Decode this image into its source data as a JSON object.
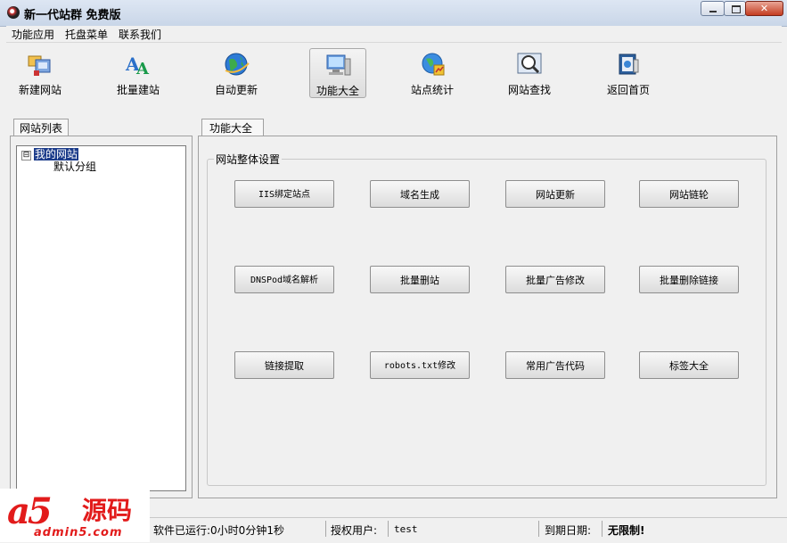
{
  "window": {
    "title": "新一代站群 免费版",
    "controls": {
      "minimize": "",
      "maximize": "",
      "close": "✕"
    }
  },
  "menu": [
    "功能应用",
    "托盘菜单",
    "联系我们"
  ],
  "toolbar": [
    {
      "label": "新建网站",
      "icon": "new-site-icon"
    },
    {
      "label": "批量建站",
      "icon": "batch-build-icon"
    },
    {
      "label": "自动更新",
      "icon": "globe-update-icon"
    },
    {
      "label": "功能大全",
      "icon": "computer-features-icon",
      "active": true
    },
    {
      "label": "站点统计",
      "icon": "stats-globe-icon"
    },
    {
      "label": "网站查找",
      "icon": "magnifier-search-icon"
    },
    {
      "label": "返回首页",
      "icon": "home-book-icon"
    }
  ],
  "left_panel": {
    "tab": "网站列表",
    "tree": {
      "toggle": "⊟",
      "root": "我的网站",
      "children": [
        "默认分组"
      ]
    }
  },
  "right_panel": {
    "tab": "功能大全",
    "group_title": "网站整体设置",
    "buttons": [
      "IIS绑定站点",
      "域名生成",
      "网站更新",
      "网站链轮",
      "DNSPod域名解析",
      "批量删站",
      "批量广告修改",
      "批量删除链接",
      "链接提取",
      "robots.txt修改",
      "常用广告代码",
      "标签大全"
    ]
  },
  "statusbar": {
    "runtime": "软件已运行:0小时0分钟1秒",
    "user_label": "授权用户:",
    "user_value": "test",
    "expiry_label": "到期日期:",
    "expiry_value": "无限制!"
  },
  "watermark": {
    "brand": "a5",
    "name": "源码",
    "url": "admin5.com"
  }
}
